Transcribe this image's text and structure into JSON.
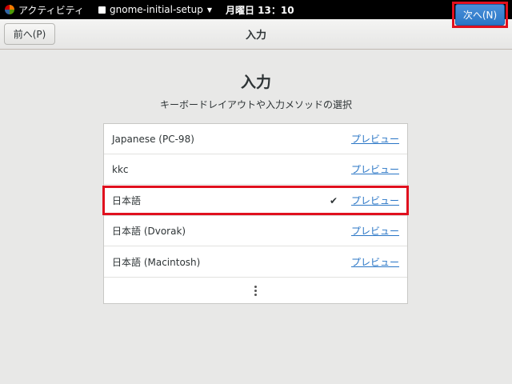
{
  "topbar": {
    "activities": "アクティビティ",
    "app_name": "gnome-initial-setup",
    "clock": "月曜日 13：10",
    "icons": [
      "volume-icon",
      "power-icon",
      "chevron-down-icon"
    ]
  },
  "header": {
    "prev_label": "前へ(P)",
    "title": "入力",
    "next_label": "次へ(N)"
  },
  "main": {
    "title": "入力",
    "subtitle": "キーボードレイアウトや入力メソッドの選択",
    "rows": [
      {
        "label": "Japanese (PC-98)",
        "preview": "プレビュー",
        "selected": false
      },
      {
        "label": "kkc",
        "preview": "プレビュー",
        "selected": false
      },
      {
        "label": "日本語",
        "preview": "プレビュー",
        "selected": true,
        "check": "✔"
      },
      {
        "label": "日本語 (Dvorak)",
        "preview": "プレビュー",
        "selected": false
      },
      {
        "label": "日本語 (Macintosh)",
        "preview": "プレビュー",
        "selected": false
      }
    ]
  },
  "colors": {
    "accent": "#2a76c6",
    "highlight": "#e0101e",
    "topbar": "#000000"
  }
}
